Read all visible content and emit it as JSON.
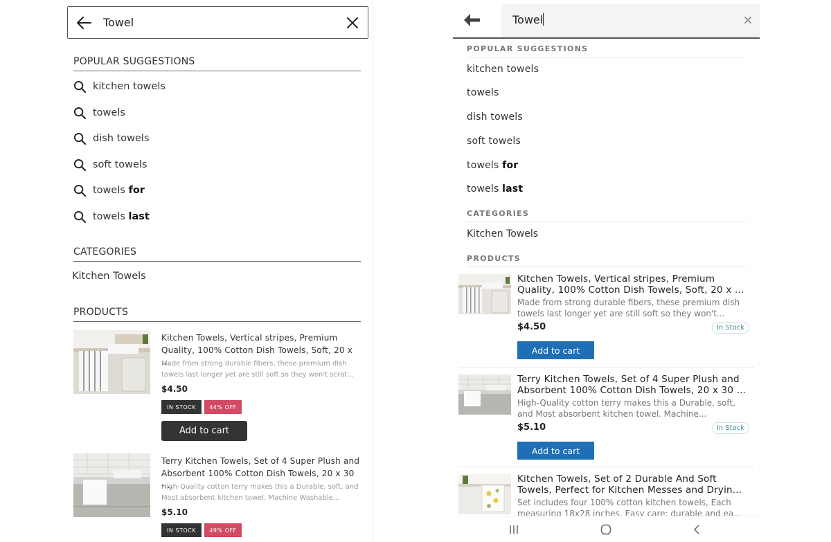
{
  "left": {
    "search": {
      "query": "Towel"
    },
    "popular_title": "POPULAR SUGGESTIONS",
    "suggestions": [
      {
        "text": "kitchen towels",
        "bold": ""
      },
      {
        "text": "towels",
        "bold": ""
      },
      {
        "text": "dish towels",
        "bold": ""
      },
      {
        "text": "soft towels",
        "bold": ""
      },
      {
        "text": "towels ",
        "bold": "for"
      },
      {
        "text": "towels ",
        "bold": "last"
      }
    ],
    "categories_title": "CATEGORIES",
    "category": "Kitchen Towels",
    "products_title": "PRODUCTS",
    "products": [
      {
        "title": "Kitchen Towels, Vertical stripes, Premium Quality, 100% Cotton Dish Towels, Soft, 20 x ...",
        "desc": "Made from strong durable fibers, these premium dish towels last longer yet are still soft so they won't scrat...",
        "price": "$4.50",
        "stock": "IN STOCK",
        "discount": "44% OFF",
        "cart": "Add to cart"
      },
      {
        "title": "Terry Kitchen Towels, Set of 4 Super Plush and Absorbent 100% Cotton Dish Towels, 20 x 30 -...",
        "desc": "High-Quality cotton terry makes this a Durable, soft, and Most absorbent kitchen towel. Machine Washable...",
        "price": "$5.10",
        "stock": "IN STOCK",
        "discount": "49% OFF"
      }
    ]
  },
  "right": {
    "search": {
      "query": "Towel"
    },
    "popular_title": "POPULAR SUGGESTIONS",
    "suggestions": [
      {
        "text": "kitchen towels",
        "bold": ""
      },
      {
        "text": "towels",
        "bold": ""
      },
      {
        "text": "dish towels",
        "bold": ""
      },
      {
        "text": "soft towels",
        "bold": ""
      },
      {
        "text": "towels ",
        "bold": "for"
      },
      {
        "text": "towels ",
        "bold": "last"
      }
    ],
    "categories_title": "CATEGORIES",
    "category": "Kitchen Towels",
    "products_title": "PRODUCTS",
    "products": [
      {
        "title1": "Kitchen Towels, Vertical stripes, Premium",
        "title2": "Quality, 100% Cotton Dish Towels, Soft, 20 x ...",
        "desc1": "Made from strong durable fibers, these premium dish",
        "desc2": "towels last longer yet are still soft so they won't...",
        "price": "$4.50",
        "stock": "In Stock",
        "cart": "Add to cart"
      },
      {
        "title1": "Terry Kitchen Towels, Set of 4 Super Plush and",
        "title2": "Absorbent 100% Cotton Dish Towels, 20 x 30 ...",
        "desc1": "High-Quality cotton terry makes this a Durable, soft,",
        "desc2": "and Most absorbent kitchen towel. Machine...",
        "price": "$5.10",
        "stock": "In Stock",
        "cart": "Add to cart"
      },
      {
        "title1": "Kitchen Towels, Set of 2 Durable And Soft",
        "title2": "Towels, Perfect for Kitchen Messes and Dryin...",
        "desc1": "Set includes four 100% cotton kitchen towels, Each",
        "desc2": "measuring 18x28 inches. Easy care: durable and ea..."
      }
    ]
  },
  "colors": {
    "left_dark_button": "#333333",
    "left_discount": "#d24a63",
    "right_cart_button": "#1e6fb5",
    "right_stock_text": "#3b8a96"
  }
}
